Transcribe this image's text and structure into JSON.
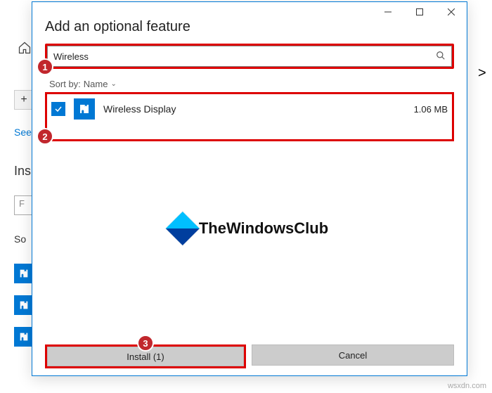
{
  "dialog": {
    "title": "Add an optional feature",
    "search_value": "Wireless",
    "sort_label": "Sort by:",
    "sort_value": "Name",
    "install_label": "Install (1)",
    "cancel_label": "Cancel"
  },
  "result": {
    "name": "Wireless Display",
    "size": "1.06 MB"
  },
  "background": {
    "see_text": "See",
    "ins_text": "Ins",
    "f_text": "F",
    "so_text": "So"
  },
  "badges": {
    "b1": "1",
    "b2": "2",
    "b3": "3"
  },
  "watermark": {
    "text": "TheWindowsClub"
  },
  "credit": "wsxdn.com"
}
